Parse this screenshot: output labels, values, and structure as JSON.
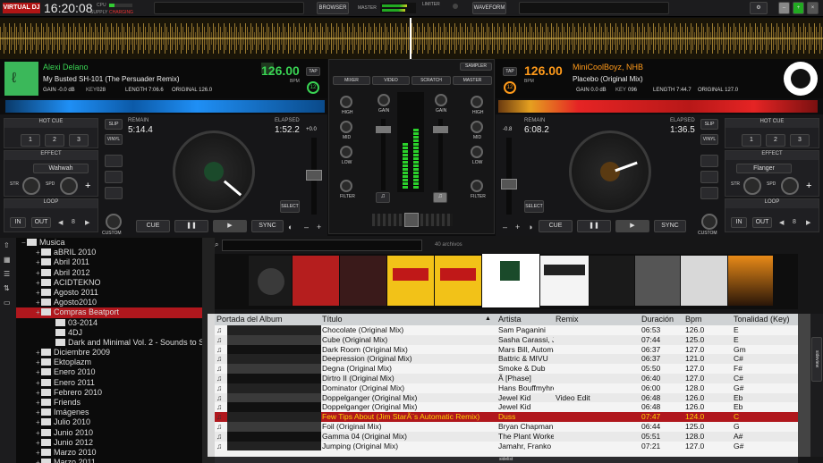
{
  "topbar": {
    "logo": "VIRTUAL DJ",
    "clock": "16:20:08",
    "cpu": "CPU",
    "supply": "SUPPLY",
    "supply_status": "CHARGING",
    "browser": "BROWSER",
    "master": "MASTER",
    "limiter": "LIMITER",
    "waveform": "WAVEFORM"
  },
  "deck_left": {
    "artist": "Alexi Delano",
    "title": "My Busted SH-101 (The Persuader Remix)",
    "bpm": "126.00",
    "bpm_unit": "BPM",
    "tap": "TAP",
    "gain": "GAIN -0.0 dB",
    "key": "KEY",
    "key_val": "028",
    "length": "LENGTH 7:06.6",
    "original": "ORIGINAL 126.0",
    "remain_label": "REMAIN",
    "remain": "5:14.4",
    "elapsed_label": "ELAPSED",
    "elapsed": "1:52.2",
    "pitch": "+0.0",
    "hot_cue": "HOT CUE",
    "effect": "EFFECT",
    "effect_name": "Wahwah",
    "loop": "LOOP",
    "loop_val": "8",
    "str": "STR",
    "spd": "SPD",
    "slip": "SLIP",
    "vinyl": "VINYL",
    "sync": "SYNC",
    "cue": "CUE",
    "select": "SELECT",
    "custom": "CUSTOM",
    "in": "IN",
    "out": "OUT",
    "pads": [
      "1",
      "2",
      "3"
    ]
  },
  "deck_right": {
    "artist": "MiniCoolBoyz, NHB",
    "title": "Placebo (Original Mix)",
    "bpm": "126.00",
    "bpm_unit": "BPM",
    "tap": "TAP",
    "gain": "GAIN 0.0 dB",
    "key": "KEY",
    "key_val": "096",
    "length": "LENGTH 7:44.7",
    "original": "ORIGINAL 127.0",
    "remain_label": "REMAIN",
    "remain": "6:08.2",
    "elapsed_label": "ELAPSED",
    "elapsed": "1:36.5",
    "pitch": "-0.8",
    "hot_cue": "HOT CUE",
    "effect": "EFFECT",
    "effect_name": "Flanger",
    "loop": "LOOP",
    "loop_val": "8",
    "str": "STR",
    "spd": "SPD",
    "slip": "SLIP",
    "vinyl": "VINYL",
    "sync": "SYNC",
    "cue": "CUE",
    "select": "SELECT",
    "custom": "CUSTOM",
    "in": "IN",
    "out": "OUT",
    "pads": [
      "1",
      "2",
      "3"
    ]
  },
  "mixer": {
    "sampler": "SAMPLER",
    "tabs": [
      "MIXER",
      "VIDEO",
      "SCRATCH",
      "MASTER"
    ],
    "high": "HIGH",
    "mid": "MID",
    "low": "LOW",
    "filter": "FILTER",
    "gain": "GAIN"
  },
  "browser": {
    "search_placeholder": "",
    "count": "40 archivos",
    "tree": [
      {
        "label": "Musica",
        "depth": 0
      },
      {
        "label": "aBRIL 2010",
        "depth": 1
      },
      {
        "label": "Abril 2011",
        "depth": 1
      },
      {
        "label": "Abril 2012",
        "depth": 1
      },
      {
        "label": "ACIDTEKNO",
        "depth": 1
      },
      {
        "label": "Agosto 2011",
        "depth": 1
      },
      {
        "label": "Agosto2010",
        "depth": 1
      },
      {
        "label": "Compras Beatport",
        "depth": 1,
        "selected": true
      },
      {
        "label": "03-2014",
        "depth": 2
      },
      {
        "label": "4DJ",
        "depth": 2
      },
      {
        "label": "Dark and Minimal Vol. 2 - Sounds to Sample",
        "depth": 2
      },
      {
        "label": "Diciembre 2009",
        "depth": 1
      },
      {
        "label": "Ektoplazm",
        "depth": 1
      },
      {
        "label": "Enero 2010",
        "depth": 1
      },
      {
        "label": "Enero 2011",
        "depth": 1
      },
      {
        "label": "Febrero 2010",
        "depth": 1
      },
      {
        "label": "Friends",
        "depth": 1
      },
      {
        "label": "Imágenes",
        "depth": 1
      },
      {
        "label": "Julio 2010",
        "depth": 1
      },
      {
        "label": "Junio 2010",
        "depth": 1
      },
      {
        "label": "Junio 2012",
        "depth": 1
      },
      {
        "label": "Marzo 2010",
        "depth": 1
      },
      {
        "label": "Marzo 2011",
        "depth": 1
      }
    ],
    "columns": [
      "Portada del Album",
      "Título",
      "Artista",
      "Remix",
      "Duración",
      "Bpm",
      "Tonalidad (Key)"
    ],
    "rows": [
      {
        "title": "Chocolate (Original Mix)",
        "artist": "Sam Paganini",
        "remix": "",
        "duration": "06:53",
        "bpm": "126.0",
        "key": "E"
      },
      {
        "title": "Cube (Original Mix)",
        "artist": "Sasha Carassi, Jay...",
        "remix": "",
        "duration": "07:44",
        "bpm": "125.0",
        "key": "E"
      },
      {
        "title": "Dark Room (Original Mix)",
        "artist": "Mars Bill, Automatik...",
        "remix": "",
        "duration": "06:37",
        "bpm": "127.0",
        "key": "Gm"
      },
      {
        "title": "Deepression (Original Mix)",
        "artist": "Battric & MIVU",
        "remix": "",
        "duration": "06:37",
        "bpm": "121.0",
        "key": "C#"
      },
      {
        "title": "Degna (Original Mix)",
        "artist": "Smoke & Dub",
        "remix": "",
        "duration": "05:50",
        "bpm": "127.0",
        "key": "F#"
      },
      {
        "title": "Dirtro II (Original Mix)",
        "artist": "Ã [Phase]",
        "remix": "",
        "duration": "06:40",
        "bpm": "127.0",
        "key": "C#"
      },
      {
        "title": "Dominator (Original Mix)",
        "artist": "Hans Bouffmyhre",
        "remix": "",
        "duration": "06:00",
        "bpm": "128.0",
        "key": "G#"
      },
      {
        "title": "Doppelganger (Original Mix)",
        "artist": "Jewel Kid",
        "remix": "Video Edit",
        "duration": "06:48",
        "bpm": "126.0",
        "key": "Eb"
      },
      {
        "title": "Doppelganger (Original Mix)",
        "artist": "Jewel Kid",
        "remix": "",
        "duration": "06:48",
        "bpm": "126.0",
        "key": "Eb"
      },
      {
        "title": "Few Tips About (Jim StarÃ¨s Automatic Remix)",
        "artist": "Duss",
        "remix": "",
        "duration": "07:47",
        "bpm": "124.0",
        "key": "C",
        "selected": true
      },
      {
        "title": "Foil (Original Mix)",
        "artist": "Bryan Chapman",
        "remix": "",
        "duration": "06:44",
        "bpm": "125.0",
        "key": "G"
      },
      {
        "title": "Gamma 04 (Original Mix)",
        "artist": "The Plant Worker",
        "remix": "",
        "duration": "05:51",
        "bpm": "128.0",
        "key": "A#"
      },
      {
        "title": "Jumping (Original Mix)",
        "artist": "Jamahr, Franko Lop...",
        "remix": "",
        "duration": "07:21",
        "bpm": "127.0",
        "key": "G#"
      }
    ],
    "cover_labels": [
      "SAM PAGANINI",
      "BLACK LEATHER",
      "DC119 EP",
      "GAINING GROUND",
      "SAMPLER ARTISTS VOL II"
    ],
    "sideview": "sideview",
    "sidelist": "sidelist",
    "tracklist_tab": "tracklist"
  },
  "colors": {
    "accent_green": "#39d353",
    "accent_orange": "#ff9a1a",
    "left_wave": "#1f8ff5",
    "right_wave": "#e52424",
    "selected_row": "#b0171d"
  }
}
